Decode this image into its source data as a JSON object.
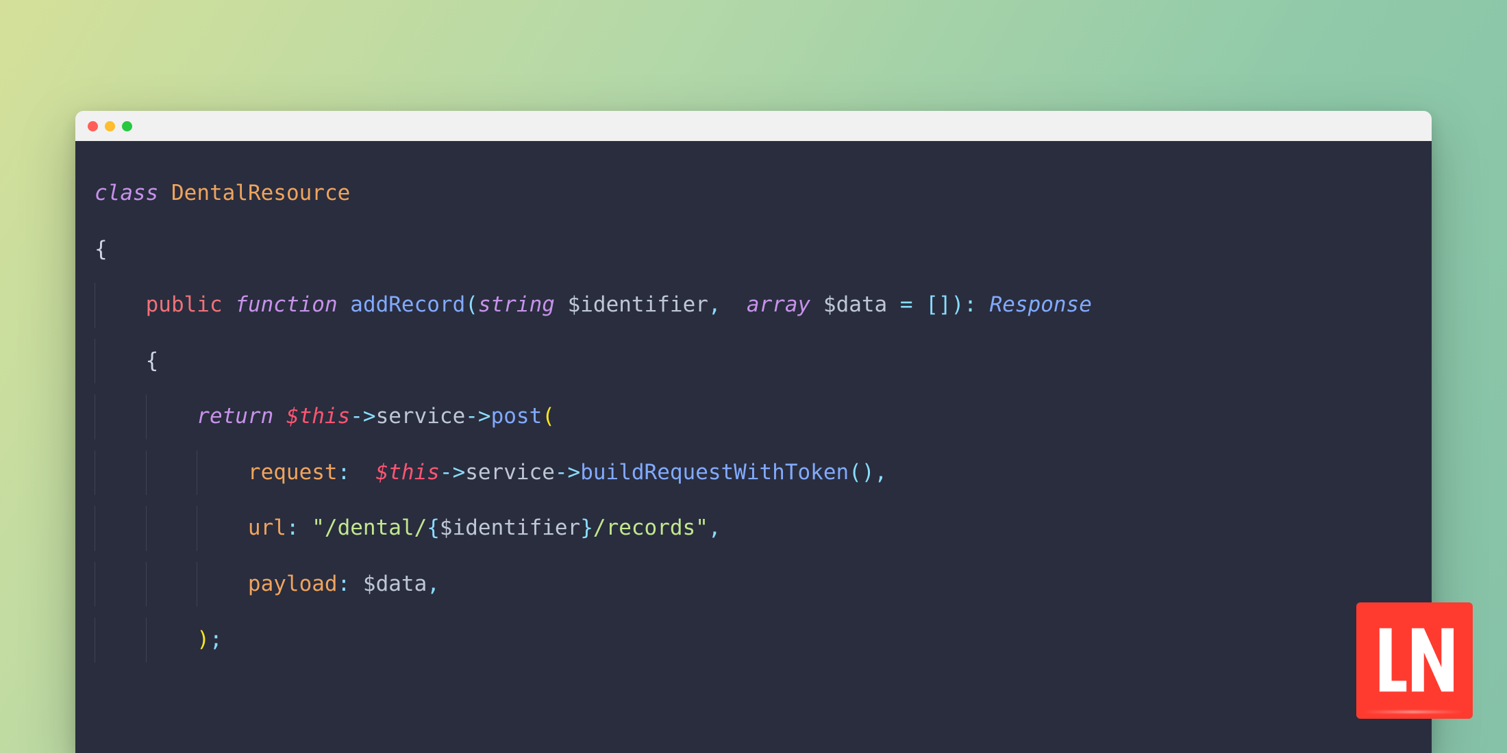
{
  "window": {
    "traffic_lights": {
      "close": "#ff5f57",
      "min": "#febc2e",
      "max": "#28c840"
    }
  },
  "code": {
    "l1_kw_class": "class",
    "l1_name": "DentalResource",
    "l2_brace": "{",
    "l3_public": "public",
    "l3_function": "function",
    "l3_fn": "addRecord",
    "l3_p1type": "string",
    "l3_p1var": "$identifier",
    "l3_sep": ",",
    "l3_p2type": "array",
    "l3_p2var": "$data",
    "l3_eq": "=",
    "l3_default": "[]",
    "l3_colon": "):",
    "l3_ret": "Response",
    "l4_brace": "{",
    "l5_return": "return",
    "l5_this": "$this",
    "l5_arrow": "->",
    "l5_service": "service",
    "l5_post": "post",
    "l6_name": "request",
    "l6_colon": ":",
    "l6_this": "$this",
    "l6_service": "service",
    "l6_fn": "buildRequestWithToken",
    "l6_tail": "(),",
    "l7_name": "url",
    "l7_colon": ":",
    "l7_str_open": "\"/dental/",
    "l7_interp_open": "{",
    "l7_interp_var": "$identifier",
    "l7_interp_close": "}",
    "l7_str_close": "/records\"",
    "l7_tail": ",",
    "l8_name": "payload",
    "l8_colon": ":",
    "l8_var": "$data",
    "l8_tail": ",",
    "l9_close": ");"
  },
  "logo": {
    "letters": "LN",
    "bg": "#ff3b30",
    "fg": "#ffffff"
  }
}
